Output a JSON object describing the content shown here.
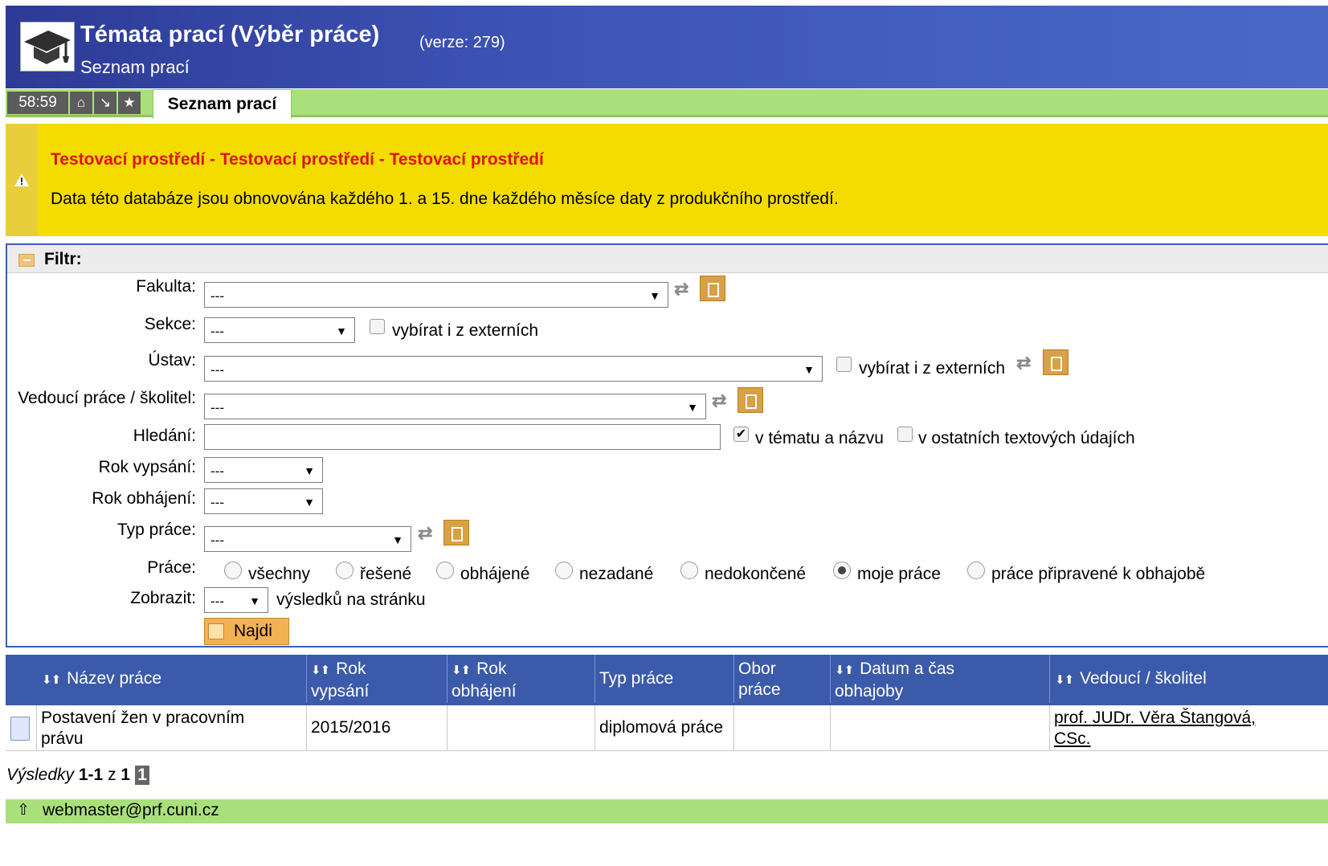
{
  "header": {
    "title": "Témata prací (Výběr práce)",
    "version": "(verze: 279)",
    "subtitle": "Seznam prací"
  },
  "toolbar": {
    "timer": "58:59",
    "active_tab": "Seznam prací"
  },
  "notice": {
    "title": "Testovací prostředí - Testovací prostředí - Testovací prostředí",
    "text": "Data této databáze jsou obnovována každého 1. a 15. dne každého měsíce daty z produkčního prostředí."
  },
  "filter": {
    "title": "Filtr:",
    "fakulta_label": "Fakulta:",
    "fakulta_value": "---",
    "sekce_label": "Sekce:",
    "sekce_value": "---",
    "sekce_ext_label": "vybírat i z externích",
    "ustav_label": "Ústav:",
    "ustav_value": "---",
    "ustav_ext_label": "vybírat i z externích",
    "vedouci_label": "Vedoucí práce / školitel:",
    "vedouci_value": "---",
    "hledani_label": "Hledání:",
    "hledani_value": "",
    "hledani_opt1": "v tématu a názvu",
    "hledani_opt2": "v ostatních textových údajích",
    "rok_vypsani_label": "Rok vypsání:",
    "rok_vypsani_value": "---",
    "rok_obhajeni_label": "Rok obhájení:",
    "rok_obhajeni_value": "---",
    "typ_label": "Typ práce:",
    "typ_value": "---",
    "prace_label": "Práce:",
    "prace_options": [
      "všechny",
      "řešené",
      "obhájené",
      "nezadané",
      "nedokončené",
      "moje práce",
      "práce připravené k obhajobě"
    ],
    "prace_selected": "moje práce",
    "zobrazit_label": "Zobrazit:",
    "zobrazit_value": "---",
    "zobrazit_suffix": "výsledků na stránku",
    "search_button": "Najdi"
  },
  "table": {
    "headers": {
      "nazev": "Název práce",
      "rok_vypsani_1": "Rok",
      "rok_vypsani_2": "vypsání",
      "rok_obhajeni_1": "Rok",
      "rok_obhajeni_2": "obhájení",
      "typ": "Typ práce",
      "obor_1": "Obor",
      "obor_2": "práce",
      "datum_1": "Datum a čas",
      "datum_2": "obhajoby",
      "vedouci": "Vedoucí / školitel"
    },
    "rows": [
      {
        "nazev_1": "Postavení žen v pracovním",
        "nazev_2": "právu",
        "rok_vypsani": "2015/2016",
        "rok_obhajeni": "",
        "typ": "diplomová práce",
        "obor": "",
        "datum": "",
        "vedouci_1": "prof. JUDr. Věra Štangová,",
        "vedouci_2": "CSc."
      }
    ]
  },
  "results": {
    "label": "Výsledky",
    "range": "1-1",
    "of": "z",
    "total": "1",
    "page": "1"
  },
  "footer": {
    "email": "webmaster@prf.cuni.cz"
  }
}
